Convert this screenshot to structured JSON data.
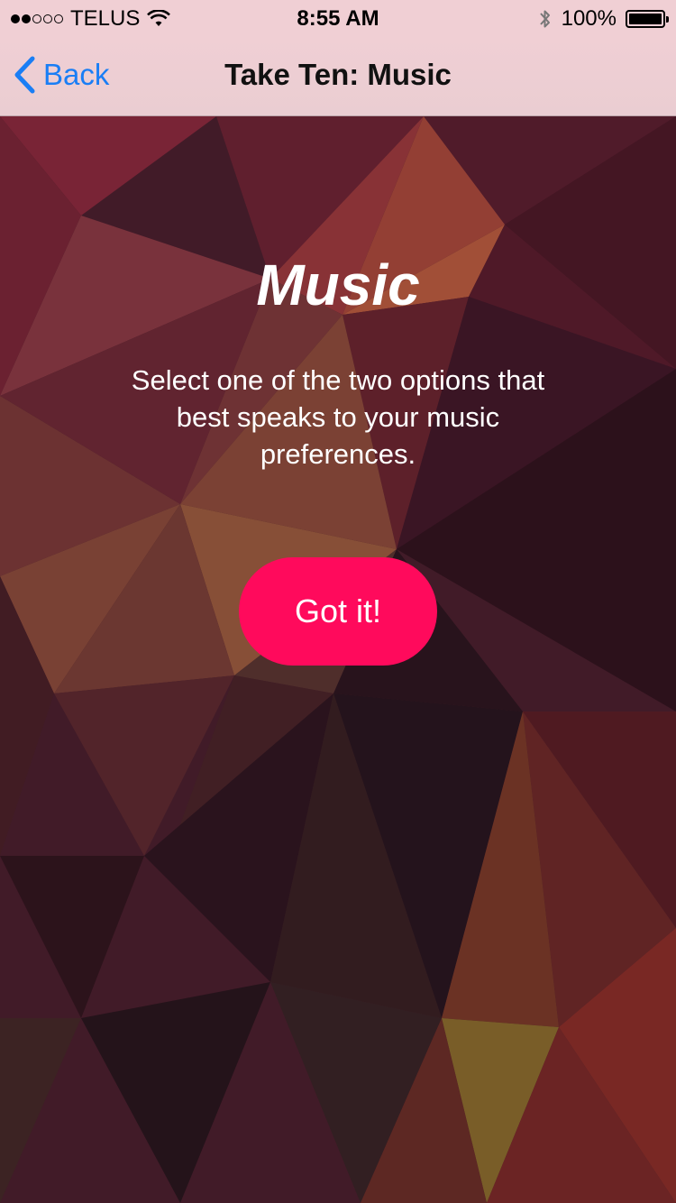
{
  "status_bar": {
    "carrier": "TELUS",
    "time": "8:55 AM",
    "battery": "100%",
    "signal_bars_filled": 2,
    "signal_bars_total": 5,
    "battery_level": 1.0
  },
  "nav": {
    "back_label": "Back",
    "title": "Take Ten: Music"
  },
  "main": {
    "headline": "Music",
    "description": "Select one of the two options that best speaks to your music preferences.",
    "button_label": "Got it!"
  },
  "colors": {
    "accent_blue": "#1a7ef5",
    "button_pink": "#ff0a5c",
    "nav_background": "#f0cfd4"
  }
}
